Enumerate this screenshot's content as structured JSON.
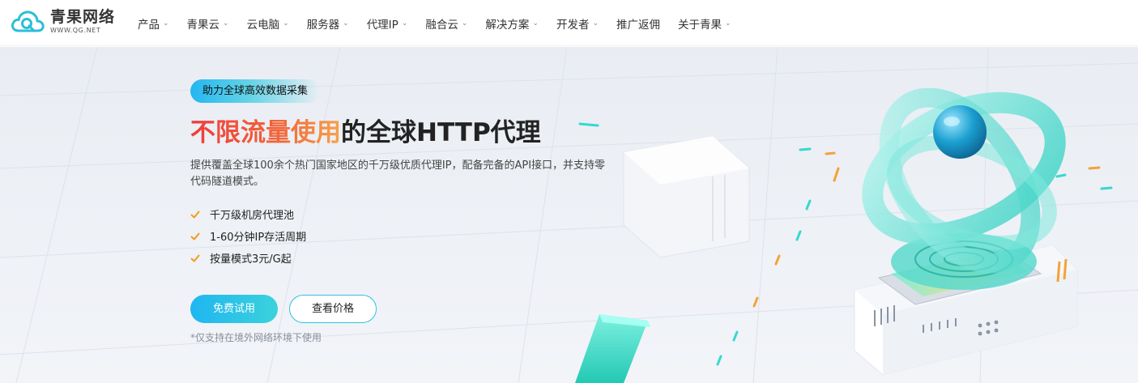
{
  "brand": {
    "name_cn": "青果网络",
    "domain": "WWW.QG.NET",
    "logo_icon": "cloud-q-icon"
  },
  "nav": {
    "items": [
      {
        "label": "产品",
        "dropdown": true
      },
      {
        "label": "青果云",
        "dropdown": true
      },
      {
        "label": "云电脑",
        "dropdown": true
      },
      {
        "label": "服务器",
        "dropdown": true
      },
      {
        "label": "代理IP",
        "dropdown": true
      },
      {
        "label": "融合云",
        "dropdown": true
      },
      {
        "label": "解决方案",
        "dropdown": true
      },
      {
        "label": "开发者",
        "dropdown": true
      },
      {
        "label": "推广返佣",
        "dropdown": false
      },
      {
        "label": "关于青果",
        "dropdown": true
      }
    ]
  },
  "hero": {
    "tagline": "助力全球高效数据采集",
    "headline_accent": "不限流量使用",
    "headline_rest": "的全球HTTP代理",
    "description": "提供覆盖全球100余个热门国家地区的千万级优质代理IP，配备完备的API接口，并支持零代码隧道模式。",
    "features": [
      "千万级机房代理池",
      "1-60分钟IP存活周期",
      "按量模式3元/G起"
    ],
    "primary_button": "免费试用",
    "secondary_button": "查看价格",
    "note": "*仅支持在境外网络环境下使用"
  },
  "colors": {
    "accent": "#1fb6f1",
    "teal": "#3bd2dc",
    "check": "#f39a1e",
    "headline_red": "#ef3b3b"
  }
}
